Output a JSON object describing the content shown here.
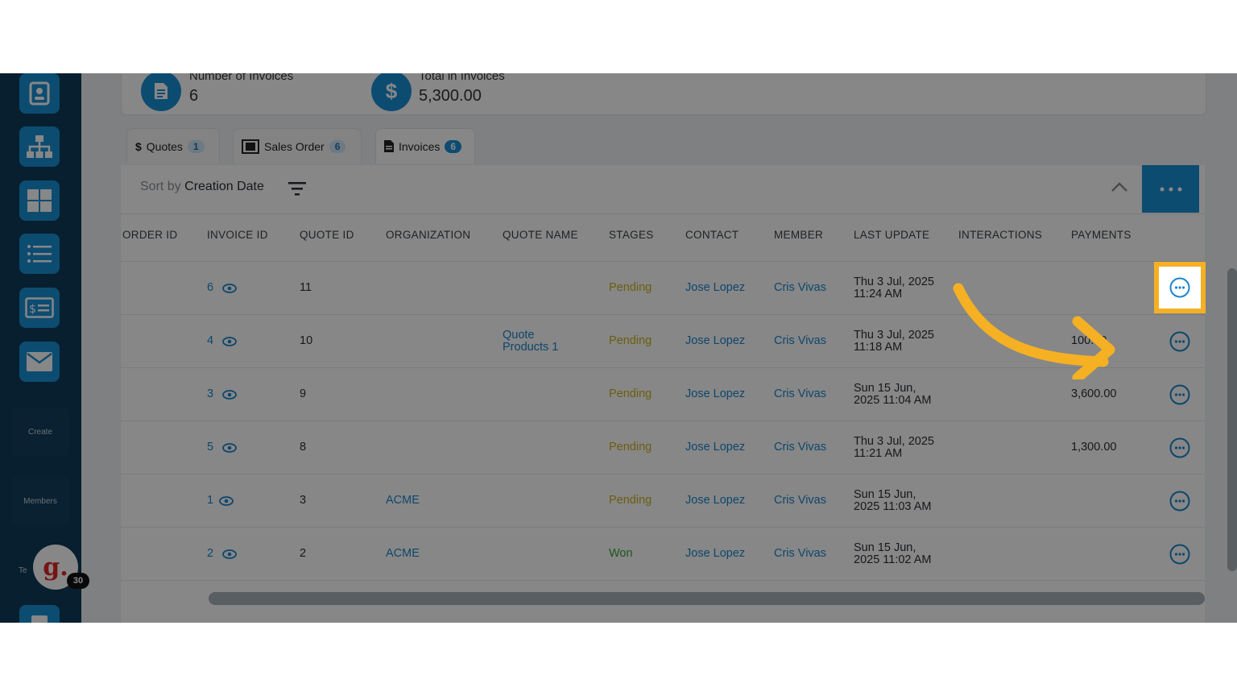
{
  "stats": {
    "invoices_label": "Number of Invoices",
    "invoices_value": "6",
    "total_label": "Total in Invoices",
    "total_value": "5,300.00",
    "total_icon_glyph": "$"
  },
  "sidebar": {
    "items": [
      {
        "icon": "contact-card-icon"
      },
      {
        "icon": "org-chart-icon"
      },
      {
        "icon": "grid-icon"
      },
      {
        "icon": "list-icon"
      },
      {
        "icon": "invoice-icon"
      },
      {
        "icon": "mail-icon"
      }
    ],
    "create_label": "Create",
    "members_label": "Members",
    "truncated_label": "Te",
    "avatar_letter": "g.",
    "avatar_badge": "30"
  },
  "tabs": [
    {
      "label": "Quotes",
      "count": "1",
      "icon_glyph": "$"
    },
    {
      "label": "Sales Order",
      "count": "6"
    },
    {
      "label": "Invoices",
      "count": "6"
    }
  ],
  "sort": {
    "prefix": "Sort by",
    "field": "Creation Date"
  },
  "table": {
    "columns": [
      "ORDER ID",
      "INVOICE ID",
      "QUOTE ID",
      "ORGANIZATION",
      "QUOTE NAME",
      "STAGES",
      "CONTACT",
      "MEMBER",
      "LAST UPDATE",
      "INTERACTIONS",
      "PAYMENTS"
    ],
    "rows": [
      {
        "invoice_id": "6",
        "quote_id": "11",
        "organization": "",
        "quote_name_1": "",
        "quote_name_2": "",
        "stage": "Pending",
        "contact": "Jose Lopez",
        "member": "Cris Vivas",
        "update_1": "Thu 3 Jul, 2025",
        "update_2": "11:24 AM",
        "payments": ""
      },
      {
        "invoice_id": "4",
        "quote_id": "10",
        "organization": "",
        "quote_name_1": "Quote",
        "quote_name_2": "Products 1",
        "stage": "Pending",
        "contact": "Jose Lopez",
        "member": "Cris Vivas",
        "update_1": "Thu 3 Jul, 2025",
        "update_2": "11:18 AM",
        "payments": "100.00"
      },
      {
        "invoice_id": "3",
        "quote_id": "9",
        "organization": "",
        "quote_name_1": "",
        "quote_name_2": "",
        "stage": "Pending",
        "contact": "Jose Lopez",
        "member": "Cris Vivas",
        "update_1": "Sun 15 Jun,",
        "update_2": "2025 11:04 AM",
        "payments": "3,600.00"
      },
      {
        "invoice_id": "5",
        "quote_id": "8",
        "organization": "",
        "quote_name_1": "",
        "quote_name_2": "",
        "stage": "Pending",
        "contact": "Jose Lopez",
        "member": "Cris Vivas",
        "update_1": "Thu 3 Jul, 2025",
        "update_2": "11:21 AM",
        "payments": "1,300.00"
      },
      {
        "invoice_id": "1",
        "quote_id": "3",
        "organization": "ACME",
        "quote_name_1": "",
        "quote_name_2": "",
        "stage": "Pending",
        "contact": "Jose Lopez",
        "member": "Cris Vivas",
        "update_1": "Sun 15 Jun,",
        "update_2": "2025 11:03 AM",
        "payments": ""
      },
      {
        "invoice_id": "2",
        "quote_id": "2",
        "organization": "ACME",
        "quote_name_1": "",
        "quote_name_2": "",
        "stage": "Won",
        "contact": "Jose Lopez",
        "member": "Cris Vivas",
        "update_1": "Sun 15 Jun,",
        "update_2": "2025 11:02 AM",
        "payments": ""
      }
    ]
  },
  "colors": {
    "accent": "#1990d6",
    "sidebar": "#0f3c5a",
    "highlight": "#f5b024",
    "pending": "#c9b21a",
    "won": "#3aa037",
    "link": "#1a86cf"
  }
}
